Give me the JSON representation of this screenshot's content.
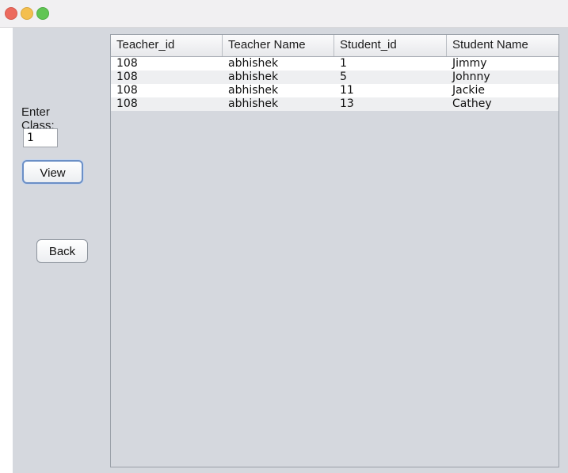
{
  "form": {
    "class_label": "Enter Class:",
    "class_value": "1",
    "view_label": "View",
    "back_label": "Back"
  },
  "table": {
    "columns": [
      "Teacher_id",
      "Teacher Name",
      "Student_id",
      "Student Name"
    ],
    "rows": [
      [
        "108",
        "abhishek",
        "1",
        "Jimmy"
      ],
      [
        "108",
        "abhishek",
        "5",
        "Johnny"
      ],
      [
        "108",
        "abhishek",
        "11",
        "Jackie"
      ],
      [
        "108",
        "abhishek",
        "13",
        "Cathey"
      ]
    ]
  },
  "colors": {
    "window_background": "#d5d8de",
    "close_light": "#ec6a5e",
    "minimize_light": "#f4bf4f",
    "zoom_light": "#61c554"
  }
}
